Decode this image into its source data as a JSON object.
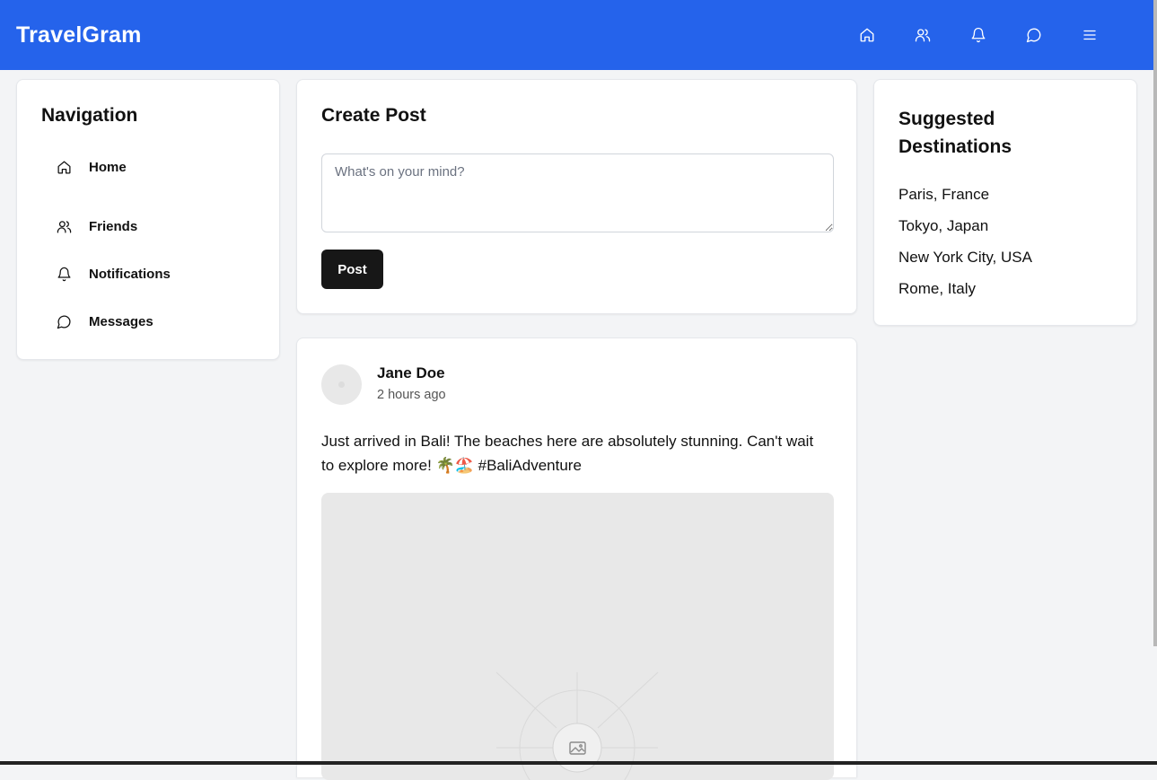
{
  "app": {
    "brand": "TravelGram"
  },
  "topnav": [
    {
      "icon": "home-icon"
    },
    {
      "icon": "friends-icon"
    },
    {
      "icon": "bell-icon"
    },
    {
      "icon": "message-icon"
    },
    {
      "icon": "menu-icon"
    }
  ],
  "navigation": {
    "title": "Navigation",
    "items": [
      {
        "label": "Home",
        "icon": "home-icon"
      },
      {
        "label": "Friends",
        "icon": "friends-icon"
      },
      {
        "label": "Notifications",
        "icon": "bell-icon"
      },
      {
        "label": "Messages",
        "icon": "message-icon"
      }
    ]
  },
  "create_post": {
    "title": "Create Post",
    "placeholder": "What's on your mind?",
    "value": "",
    "button_label": "Post"
  },
  "destinations": {
    "title": "Suggested Destinations",
    "items": [
      "Paris, France",
      "Tokyo, Japan",
      "New York City, USA",
      "Rome, Italy"
    ]
  },
  "feed": [
    {
      "author": "Jane Doe",
      "time": "2 hours ago",
      "text": "Just arrived in Bali! The beaches here are absolutely stunning. Can't wait to explore more! 🌴🏖️ #BaliAdventure",
      "image_icon": "image-placeholder-icon"
    }
  ],
  "colors": {
    "header": "#2563eb",
    "button": "#171717",
    "background": "#f3f4f6"
  }
}
